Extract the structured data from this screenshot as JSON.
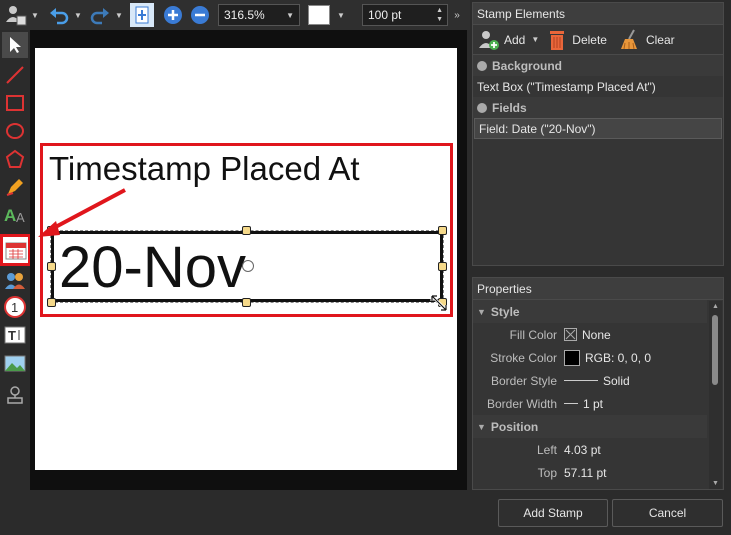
{
  "toolbar": {
    "zoom_value": "316.5%",
    "stroke_width_value": "100 pt"
  },
  "tools": [
    {
      "icon": "select-arrow-icon"
    },
    {
      "icon": "line-icon"
    },
    {
      "icon": "rectangle-icon"
    },
    {
      "icon": "ellipse-icon"
    },
    {
      "icon": "polygon-icon"
    },
    {
      "icon": "pencil-icon"
    },
    {
      "icon": "text-icon"
    },
    {
      "icon": "date-icon"
    },
    {
      "icon": "users-icon"
    },
    {
      "icon": "number-icon"
    },
    {
      "icon": "text-box-icon"
    },
    {
      "icon": "image-icon"
    },
    {
      "icon": "stamp-icon"
    }
  ],
  "canvas": {
    "title_text": "Timestamp Placed At",
    "date_text": "20-Nov"
  },
  "stamp_elements": {
    "title": "Stamp Elements",
    "add_label": "Add",
    "delete_label": "Delete",
    "clear_label": "Clear",
    "background_section": "Background",
    "background_item": "Text Box (\"Timestamp Placed At\")",
    "fields_section": "Fields",
    "fields_item": "Field: Date (\"20-Nov\")"
  },
  "properties": {
    "title": "Properties",
    "style_section": "Style",
    "fill_color_label": "Fill Color",
    "fill_color_value": "None",
    "stroke_color_label": "Stroke Color",
    "stroke_color_value": "RGB: 0, 0, 0",
    "border_style_label": "Border Style",
    "border_style_value": "Solid",
    "border_width_label": "Border Width",
    "border_width_value": "1 pt",
    "position_section": "Position",
    "left_label": "Left",
    "left_value": "4.03 pt",
    "top_label": "Top",
    "top_value": "57.11 pt"
  },
  "footer": {
    "add_stamp_label": "Add Stamp",
    "cancel_label": "Cancel"
  },
  "colors": {
    "highlight_red": "#e0161c",
    "selection_row": "#454545"
  }
}
